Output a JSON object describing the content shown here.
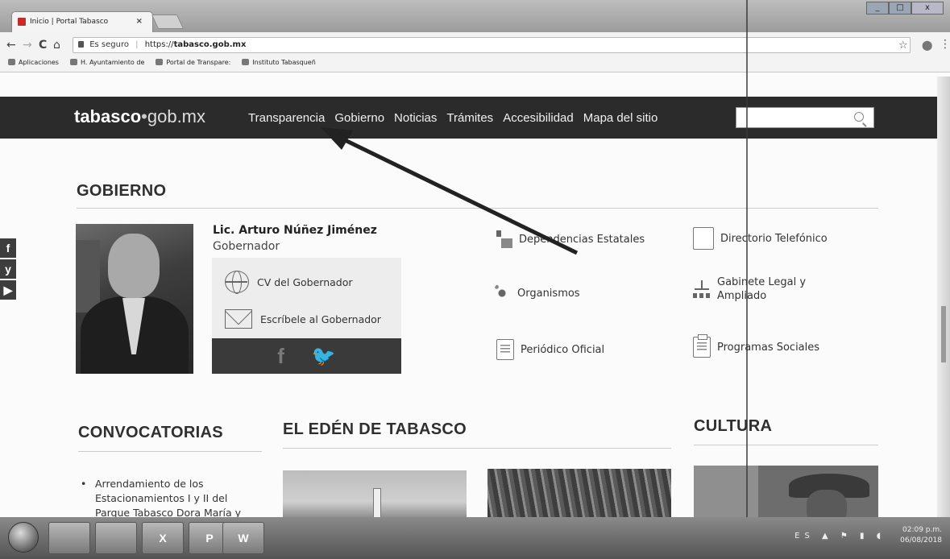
{
  "browser": {
    "tab_title": "Inicio | Portal Tabasco",
    "tab_close": "×",
    "back": "←",
    "forward": "→",
    "reload": "C",
    "home": "⌂",
    "security_label": "Es seguro",
    "separator": "|",
    "url_prefix": "https://",
    "url_host": "tabasco.gob.mx",
    "star": "☆",
    "menu": "⋮",
    "bookmarks": [
      "Aplicaciones",
      "H. Ayuntamiento de",
      "Portal de Transpare:",
      "Instituto Tabasqueñ"
    ]
  },
  "site": {
    "logo_bold": "tabasco",
    "logo_dot": "•",
    "logo_light": "gob.mx",
    "nav": [
      "Transparencia",
      "Gobierno",
      "Noticias",
      "Trámites",
      "Accesibilidad",
      "Mapa del sitio"
    ],
    "search_placeholder": ""
  },
  "social_sidebar": [
    "f",
    "y",
    "▶"
  ],
  "gobierno": {
    "heading": "GOBIERNO",
    "governor_name": "Lic. Arturo Núñez Jiménez",
    "governor_role": "Gobernador",
    "cv_link": "CV del Gobernador",
    "write_link": "Escríbele al Gobernador",
    "social": [
      "f",
      "🐦"
    ],
    "services": [
      {
        "label": "Dependencias Estatales",
        "icon": "house-person-icon"
      },
      {
        "label": "Directorio Telefónico",
        "icon": "book-icon"
      },
      {
        "label": "Organismos",
        "icon": "network-dots-icon"
      },
      {
        "label_line1": "Gabinete Legal y",
        "label_line2": "Ampliado",
        "icon": "org-chart-icon"
      },
      {
        "label": "Periódico Oficial",
        "icon": "newspaper-icon"
      },
      {
        "label": "Programas Sociales",
        "icon": "clipboard-icon"
      }
    ]
  },
  "convocatorias": {
    "heading": "CONVOCATORIAS",
    "bullet": "•",
    "item": "Arrendamiento de los Estacionamientos I y II del Parque Tabasco Dora María y"
  },
  "eden": {
    "heading": "EL EDÉN DE TABASCO"
  },
  "cultura": {
    "heading": "CULTURA"
  },
  "taskbar": {
    "apps": [
      "",
      "",
      "X",
      "P",
      "W"
    ],
    "tray_lang": "ES",
    "clock_time": "02:09 p.m.",
    "clock_date": "06/08/2018"
  }
}
